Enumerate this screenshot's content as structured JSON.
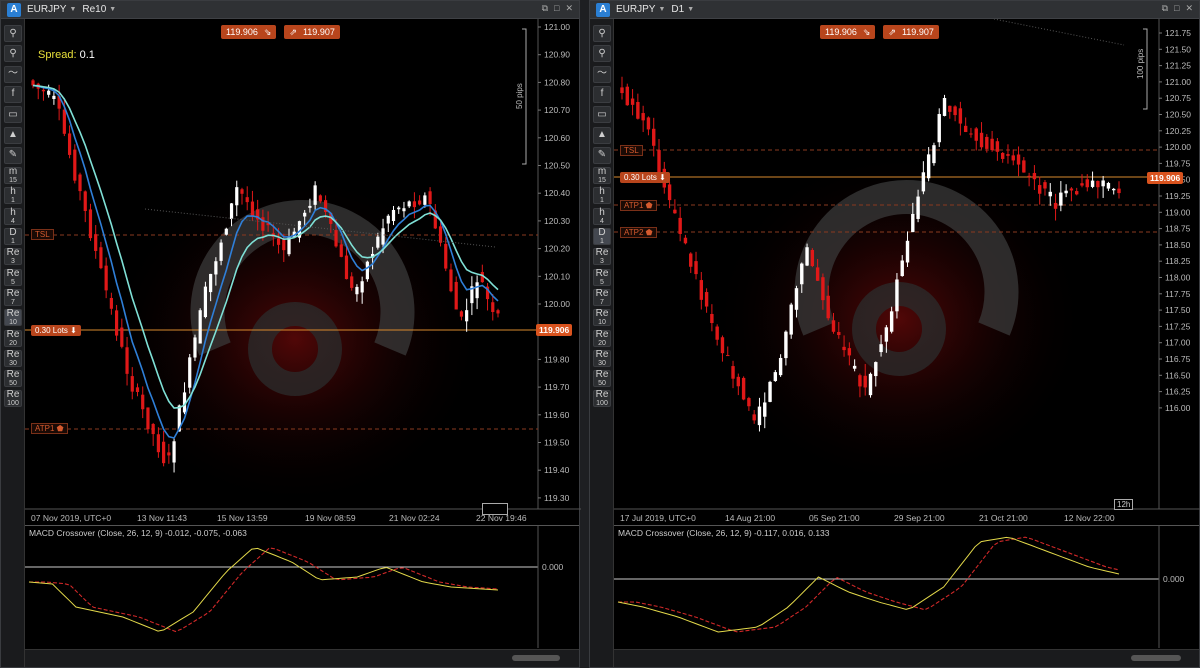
{
  "left": {
    "symbol": "EURJPY",
    "timeframe": "Re10",
    "bid_button": "119.906",
    "ask_button": "119.907",
    "spread_label": "Spread:",
    "spread_value": "0.1",
    "price_tag": "119.906",
    "lots_label": "0.30 Lots",
    "scale_label": "50 pips",
    "timeframe_tag": "",
    "levels": [
      "TSL",
      "ATP1"
    ],
    "axis_labels": [
      "121.00",
      "120.90",
      "120.80",
      "120.70",
      "120.60",
      "120.50",
      "120.40",
      "120.30",
      "120.20",
      "120.10",
      "120.00",
      "119.90",
      "119.80",
      "119.70",
      "119.60",
      "119.50",
      "119.40",
      "119.30"
    ],
    "time_labels": [
      "07 Nov 2019, UTC+0",
      "13 Nov 11:43",
      "15 Nov 13:59",
      "19 Nov 08:59",
      "21 Nov 02:24",
      "22 Nov 19:46"
    ],
    "indicator_title": "MACD Crossover (Close, 26, 12, 9) -0.012, -0.075, -0.063",
    "indicator_zero": "0.000",
    "toolbar": [
      {
        "icon": "zoom-in-icon",
        "glyph": "⚲",
        "sub": ""
      },
      {
        "icon": "zoom-out-icon",
        "glyph": "⚲",
        "sub": ""
      },
      {
        "icon": "indicator-icon",
        "glyph": "〜",
        "sub": ""
      },
      {
        "icon": "facebook-icon",
        "glyph": "f",
        "sub": ""
      },
      {
        "icon": "chart-type-icon",
        "glyph": "▭",
        "sub": ""
      },
      {
        "icon": "objects-icon",
        "glyph": "▲",
        "sub": ""
      },
      {
        "icon": "settings-icon",
        "glyph": "✎",
        "sub": ""
      },
      {
        "icon": "tf-m15",
        "glyph": "m",
        "sub": "15"
      },
      {
        "icon": "tf-h1",
        "glyph": "h",
        "sub": "1"
      },
      {
        "icon": "tf-h4",
        "glyph": "h",
        "sub": "4"
      },
      {
        "icon": "tf-d1",
        "glyph": "D",
        "sub": "1"
      },
      {
        "icon": "tf-re3",
        "glyph": "Re",
        "sub": "3"
      },
      {
        "icon": "tf-re5",
        "glyph": "Re",
        "sub": "5"
      },
      {
        "icon": "tf-re7",
        "glyph": "Re",
        "sub": "7"
      },
      {
        "icon": "tf-re10",
        "glyph": "Re",
        "sub": "10"
      },
      {
        "icon": "tf-re20",
        "glyph": "Re",
        "sub": "20"
      },
      {
        "icon": "tf-re30",
        "glyph": "Re",
        "sub": "30"
      },
      {
        "icon": "tf-re50",
        "glyph": "Re",
        "sub": "50"
      },
      {
        "icon": "tf-re100",
        "glyph": "Re",
        "sub": "100"
      }
    ]
  },
  "right": {
    "symbol": "EURJPY",
    "timeframe": "D1",
    "bid_button": "119.906",
    "ask_button": "119.907",
    "price_tag": "119.906",
    "lots_label": "0.30 Lots",
    "scale_label": "100 pips",
    "timeframe_tag": "12h",
    "levels": [
      "TSL",
      "ATP1",
      "ATP2"
    ],
    "axis_labels": [
      "121.75",
      "121.50",
      "121.25",
      "121.00",
      "120.75",
      "120.50",
      "120.25",
      "120.00",
      "119.75",
      "119.50",
      "119.25",
      "119.00",
      "118.75",
      "118.50",
      "118.25",
      "118.00",
      "117.75",
      "117.50",
      "117.25",
      "117.00",
      "116.75",
      "116.50",
      "116.25",
      "116.00"
    ],
    "time_labels": [
      "17 Jul 2019, UTC+0",
      "14 Aug 21:00",
      "05 Sep 21:00",
      "29 Sep 21:00",
      "21 Oct 21:00",
      "12 Nov 22:00"
    ],
    "indicator_title": "MACD Crossover (Close, 26, 12, 9) -0.117, 0.016, 0.133",
    "indicator_zero": "0.000",
    "toolbar": [
      {
        "icon": "zoom-in-icon",
        "glyph": "⚲",
        "sub": ""
      },
      {
        "icon": "zoom-out-icon",
        "glyph": "⚲",
        "sub": ""
      },
      {
        "icon": "indicator-icon",
        "glyph": "〜",
        "sub": ""
      },
      {
        "icon": "facebook-icon",
        "glyph": "f",
        "sub": ""
      },
      {
        "icon": "chart-type-icon",
        "glyph": "▭",
        "sub": ""
      },
      {
        "icon": "objects-icon",
        "glyph": "▲",
        "sub": ""
      },
      {
        "icon": "settings-icon",
        "glyph": "✎",
        "sub": ""
      },
      {
        "icon": "tf-m15",
        "glyph": "m",
        "sub": "15"
      },
      {
        "icon": "tf-h1",
        "glyph": "h",
        "sub": "1"
      },
      {
        "icon": "tf-h4",
        "glyph": "h",
        "sub": "4"
      },
      {
        "icon": "tf-d1",
        "glyph": "D",
        "sub": "1"
      },
      {
        "icon": "tf-re3",
        "glyph": "Re",
        "sub": "3"
      },
      {
        "icon": "tf-re5",
        "glyph": "Re",
        "sub": "5"
      },
      {
        "icon": "tf-re7",
        "glyph": "Re",
        "sub": "7"
      },
      {
        "icon": "tf-re10",
        "glyph": "Re",
        "sub": "10"
      },
      {
        "icon": "tf-re20",
        "glyph": "Re",
        "sub": "20"
      },
      {
        "icon": "tf-re30",
        "glyph": "Re",
        "sub": "30"
      },
      {
        "icon": "tf-re50",
        "glyph": "Re",
        "sub": "50"
      },
      {
        "icon": "tf-re100",
        "glyph": "Re",
        "sub": "100"
      }
    ]
  },
  "colors": {
    "bull": "#ffffff",
    "bear": "#e01818",
    "ema_fast": "#7fe0d6",
    "ema_slow": "#2f7fd8",
    "macd": "#e3d94a",
    "signal": "#d02828",
    "accent": "#d9531e"
  }
}
